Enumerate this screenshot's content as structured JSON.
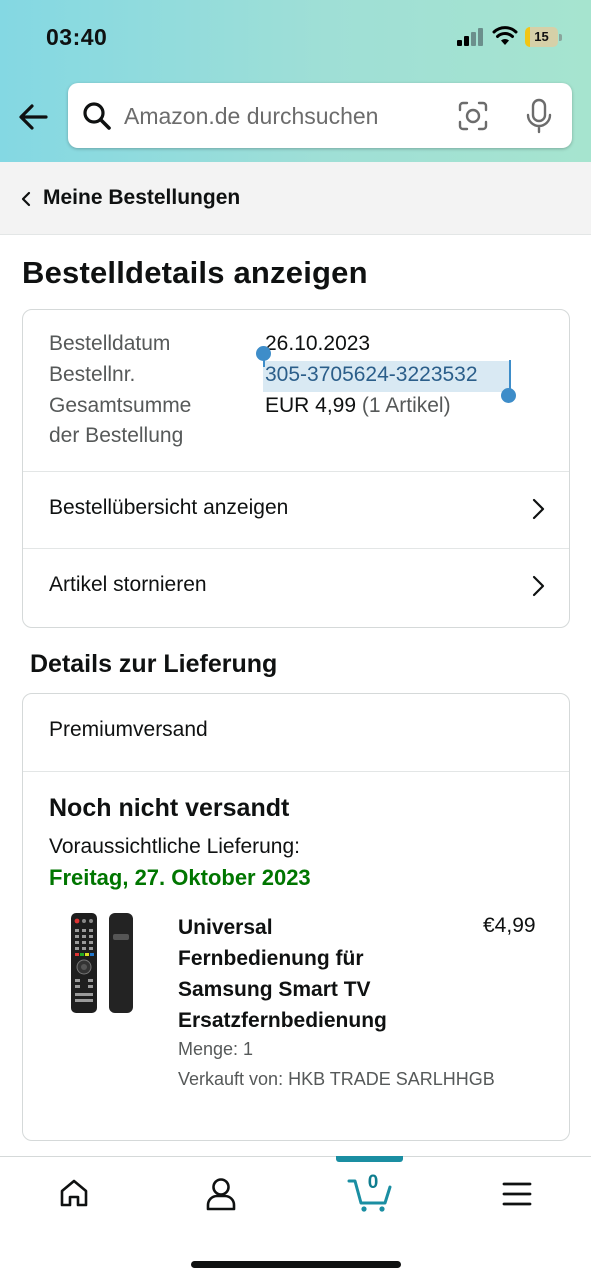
{
  "status_bar": {
    "time": "03:40",
    "battery": "15"
  },
  "search": {
    "placeholder": "Amazon.de durchsuchen"
  },
  "breadcrumb": {
    "label": "Meine Bestellungen"
  },
  "page_title": "Bestelldetails anzeigen",
  "order": {
    "date_label": "Bestelldatum",
    "date_value": "26.10.2023",
    "number_label": "Bestellnr.",
    "number_value": "305-3705624-3223532",
    "total_label_1": "Gesamtsumme",
    "total_label_2": "der Bestellung",
    "total_value": "EUR 4,99",
    "total_count": "(1 Artikel)"
  },
  "actions": {
    "summary": "Bestellübersicht anzeigen",
    "cancel": "Artikel stornieren"
  },
  "delivery": {
    "section_title": "Details zur Lieferung",
    "shipping_type": "Premiumversand",
    "status": "Noch nicht versandt",
    "eta_label": "Voraussichtliche Lieferung:",
    "eta_date": "Freitag, 27. Oktober 2023"
  },
  "product": {
    "title_1": "Universal",
    "title_2": "Fernbedienung für",
    "title_3": "Samsung Smart TV",
    "title_4": "Ersatzfernbedienung",
    "price": "€4,99",
    "quantity": "Menge: 1",
    "seller": "Verkauft von: HKB TRADE SARLHHGB"
  },
  "bottom_nav": {
    "cart_count": "0",
    "active_tab": "cart"
  },
  "colors": {
    "accent_teal": "#1a8ea2",
    "delivery_green": "#007600",
    "selection": "#d9e9f3"
  }
}
